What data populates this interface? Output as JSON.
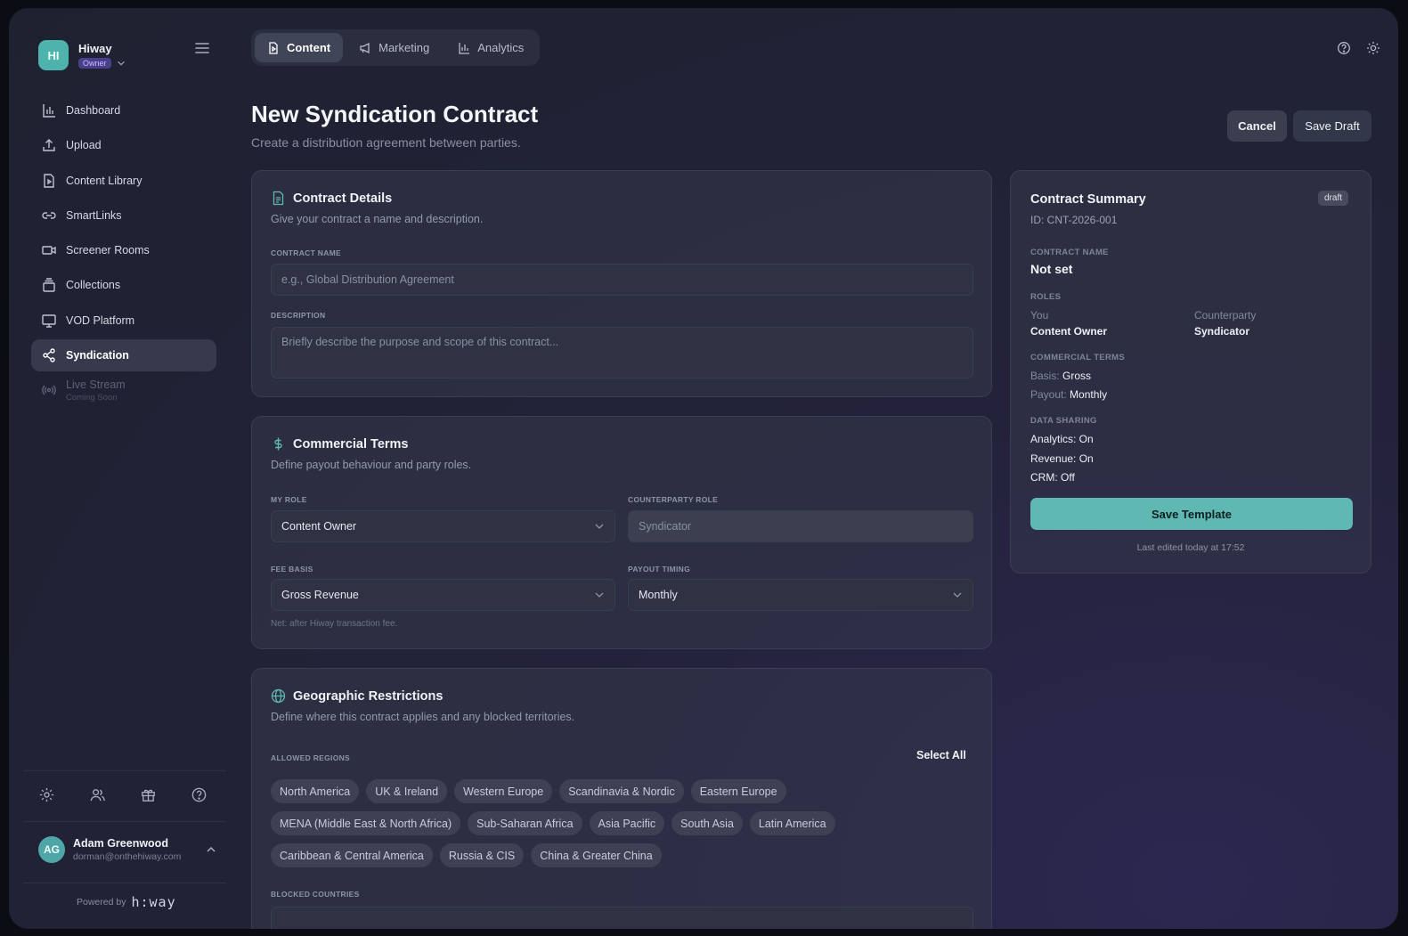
{
  "brand": {
    "initials": "HI",
    "name": "Hiway",
    "role": "Owner"
  },
  "nav": [
    {
      "label": "Dashboard",
      "icon": "bar-chart-icon"
    },
    {
      "label": "Upload",
      "icon": "upload-icon"
    },
    {
      "label": "Content Library",
      "icon": "file-video-icon"
    },
    {
      "label": "SmartLinks",
      "icon": "link-icon"
    },
    {
      "label": "Screener Rooms",
      "icon": "video-camera-icon"
    },
    {
      "label": "Collections",
      "icon": "collections-icon"
    },
    {
      "label": "VOD Platform",
      "icon": "monitor-icon"
    },
    {
      "label": "Syndication",
      "icon": "share-icon",
      "active": true
    },
    {
      "label": "Live Stream",
      "sub": "Coming Soon",
      "icon": "broadcast-icon",
      "disabled": true
    }
  ],
  "user": {
    "initials": "AG",
    "name": "Adam Greenwood",
    "email": "dorman@onthehiway.com"
  },
  "powered": {
    "label": "Powered by",
    "logo": "h:way"
  },
  "tabs": [
    {
      "label": "Content",
      "active": true
    },
    {
      "label": "Marketing"
    },
    {
      "label": "Analytics"
    }
  ],
  "header": {
    "title": "New Syndication Contract",
    "subtitle": "Create a distribution agreement between parties.",
    "cancel": "Cancel",
    "save_draft": "Save Draft"
  },
  "details": {
    "title": "Contract Details",
    "subtitle": "Give your contract a name and description.",
    "name_label": "CONTRACT NAME",
    "name_placeholder": "e.g., Global Distribution Agreement",
    "desc_label": "DESCRIPTION",
    "desc_placeholder": "Briefly describe the purpose and scope of this contract..."
  },
  "commercial": {
    "title": "Commercial Terms",
    "subtitle": "Define payout behaviour and party roles.",
    "my_role_label": "MY ROLE",
    "my_role": "Content Owner",
    "counter_label": "COUNTERPARTY ROLE",
    "counter_role": "Syndicator",
    "fee_label": "FEE BASIS",
    "fee_basis": "Gross Revenue",
    "timing_label": "PAYOUT TIMING",
    "payout_timing": "Monthly",
    "hint": "Net: after Hiway transaction fee."
  },
  "geo": {
    "title": "Geographic Restrictions",
    "subtitle": "Define where this contract applies and any blocked territories.",
    "allowed_label": "ALLOWED REGIONS",
    "select_all": "Select All",
    "regions_row1": [
      "North America",
      "UK & Ireland",
      "Western Europe",
      "Scandinavia & Nordic",
      "Eastern Europe"
    ],
    "regions_row2": [
      "MENA (Middle East & North Africa)",
      "Sub-Saharan Africa",
      "Asia Pacific",
      "South Asia",
      "Latin America"
    ],
    "regions_row3": [
      "Caribbean & Central America",
      "Russia & CIS",
      "China & Greater China"
    ],
    "blocked_label": "BLOCKED COUNTRIES"
  },
  "summary": {
    "title": "Contract Summary",
    "badge": "draft",
    "id": "ID: CNT-2026-001",
    "name_label": "CONTRACT NAME",
    "name_value": "Not set",
    "roles_label": "ROLES",
    "you_label": "You",
    "you_value": "Content Owner",
    "counter_label": "Counterparty",
    "counter_value": "Syndicator",
    "terms_label": "COMMERCIAL TERMS",
    "basis_label": "Basis:",
    "basis_value": "Gross",
    "payout_label": "Payout:",
    "payout_value": "Monthly",
    "sharing_label": "DATA SHARING",
    "analytics": "Analytics: On",
    "revenue": "Revenue: On",
    "crm": "CRM: Off",
    "save_template": "Save Template",
    "last_edited": "Last edited today at 17:52"
  },
  "colors": {
    "accent": "#5fb8b1",
    "role_badge": "#4a3f8c"
  }
}
